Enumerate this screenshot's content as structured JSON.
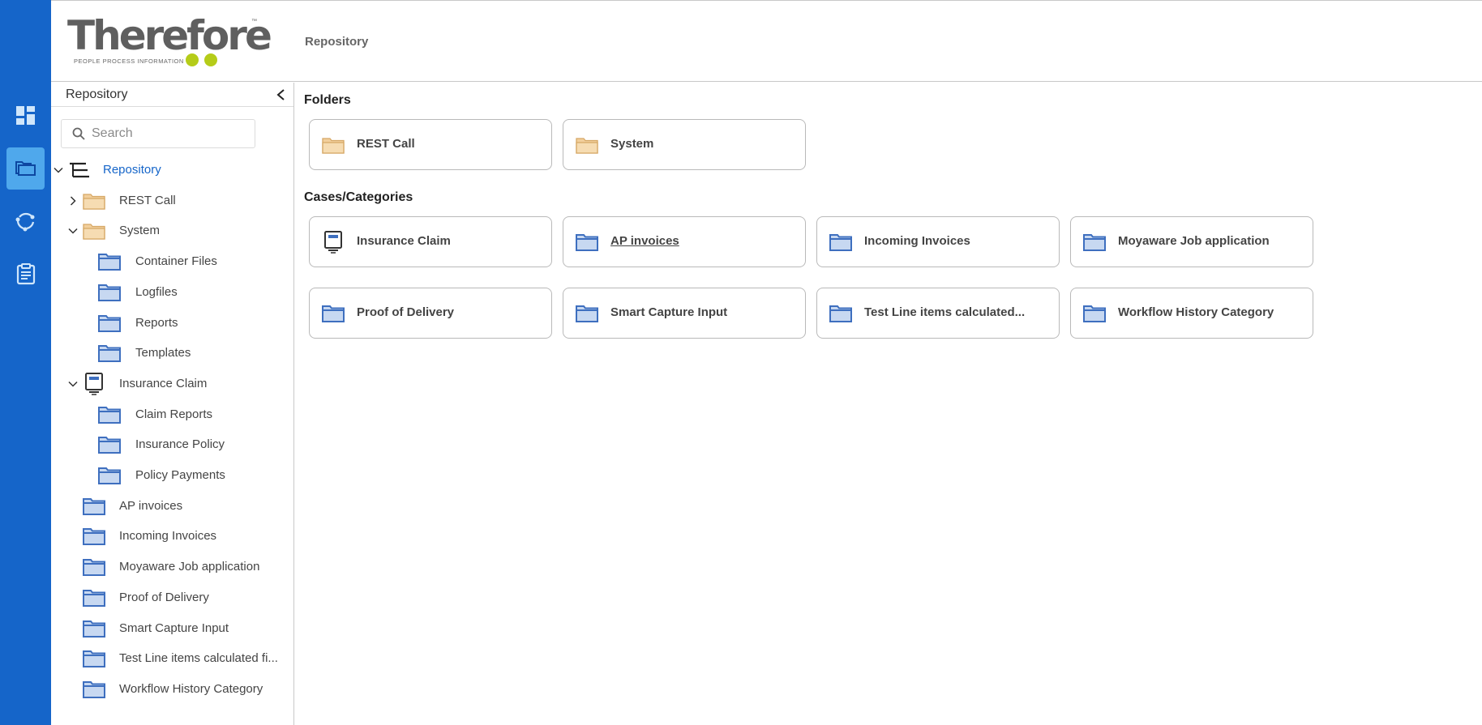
{
  "header": {
    "title": "Repository"
  },
  "logo": {
    "word": "Therefore",
    "tagline": "PEOPLE  PROCESS  INFORMATION",
    "tm": "™"
  },
  "rail": {
    "items": [
      {
        "icon": "dashboard-icon"
      },
      {
        "icon": "repository-icon",
        "active": true
      },
      {
        "icon": "workflow-icon"
      },
      {
        "icon": "tasks-icon"
      }
    ]
  },
  "sidebar": {
    "title": "Repository",
    "search": {
      "placeholder": "Search",
      "value": ""
    },
    "tree": [
      {
        "label": "Repository"
      },
      {
        "label": "REST Call"
      },
      {
        "label": "System"
      },
      {
        "label": "Container Files"
      },
      {
        "label": "Logfiles"
      },
      {
        "label": "Reports"
      },
      {
        "label": "Templates"
      },
      {
        "label": "Insurance Claim"
      },
      {
        "label": "Claim Reports"
      },
      {
        "label": "Insurance Policy"
      },
      {
        "label": "Policy Payments"
      },
      {
        "label": "AP invoices"
      },
      {
        "label": "Incoming Invoices"
      },
      {
        "label": "Moyaware Job application"
      },
      {
        "label": "Proof of Delivery"
      },
      {
        "label": "Smart Capture Input"
      },
      {
        "label": "Test Line items calculated fi..."
      },
      {
        "label": "Workflow History Category"
      }
    ]
  },
  "main": {
    "folders_title": "Folders",
    "folders": [
      {
        "label": "REST Call"
      },
      {
        "label": "System"
      }
    ],
    "categories_title": "Cases/Categories",
    "categories": [
      {
        "label": "Insurance Claim"
      },
      {
        "label": "AP invoices"
      },
      {
        "label": "Incoming Invoices"
      },
      {
        "label": "Moyaware Job application"
      },
      {
        "label": "Proof of Delivery"
      },
      {
        "label": "Smart Capture Input"
      },
      {
        "label": "Test Line items calculated..."
      },
      {
        "label": "Workflow History Category"
      }
    ]
  },
  "colors": {
    "rail": "#1565c9",
    "rail_active": "#4fa8ec",
    "link": "#1565c9",
    "logo_dot": "#b5cc19",
    "folder": "#f2cf9c",
    "category": "#3e6fbf"
  }
}
